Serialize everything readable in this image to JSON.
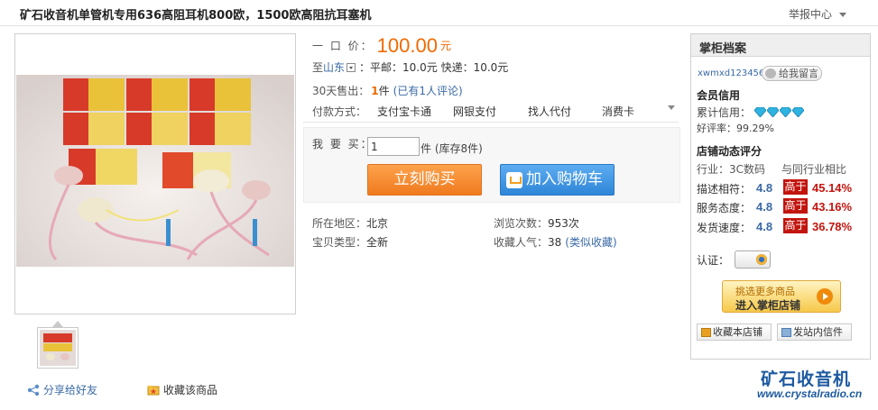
{
  "header": {
    "title": "矿石收音机单管机专用636高阻耳机800欧，1500欧高阻抗耳塞机",
    "report_label": "举报中心"
  },
  "gallery": {
    "thumb_count": 1,
    "share_label": "分享给好友",
    "collect_label": "收藏该商品"
  },
  "price": {
    "label": "一 口 价：",
    "value": "100.00",
    "unit": "元"
  },
  "shipping": {
    "to_prefix": "至",
    "destination": "山东",
    "text": "：平邮：10.0元  快递：10.0元"
  },
  "sales": {
    "label": "30天售出：",
    "count": "1",
    "unit": "件",
    "reviews": "(已有1人评论)"
  },
  "payment": {
    "label": "付款方式：",
    "options": [
      "支付宝卡通",
      "网银支付",
      "找人代付",
      "消费卡"
    ]
  },
  "purchase": {
    "qty_label": "我 要 买：",
    "qty_value": "1",
    "stock_text": "件  (库存8件)",
    "buy_now_label": "立刻购买",
    "add_cart_label": "加入购物车"
  },
  "details": {
    "region_label": "所在地区：",
    "region": "北京",
    "views_label": "浏览次数：",
    "views": "953次",
    "type_label": "宝贝类型：",
    "type": "全新",
    "fav_label": "收藏人气：",
    "fav_count": "38",
    "fav_link": "(类似收藏)"
  },
  "seller": {
    "panel_title": "掌柜档案",
    "username": "xwmxd123456",
    "message_button": "给我留言",
    "member_credit_heading": "会员信用",
    "credit_label": "累计信用：",
    "diamond_count": 4,
    "positive_rate_label": "好评率：",
    "positive_rate": "99.29%",
    "shop_rating_heading": "店铺动态评分",
    "industry_label": "行业：3C数码",
    "compare_label": "与同行业相比",
    "scores": [
      {
        "label": "描述相符：",
        "value": "4.8",
        "tag": "高于",
        "pct": "45.14%"
      },
      {
        "label": "服务态度：",
        "value": "4.8",
        "tag": "高于",
        "pct": "43.16%"
      },
      {
        "label": "发货速度：",
        "value": "4.8",
        "tag": "高于",
        "pct": "36.78%"
      }
    ],
    "cert_label": "认证：",
    "enter_shop_line1": "挑选更多商品",
    "enter_shop_line2": "进入掌柜店铺",
    "fav_shop_label": "收藏本店铺",
    "send_msg_label": "发站内信件"
  },
  "watermark": {
    "site_name": "矿石收音机",
    "url": "www.crystalradio.cn"
  },
  "colors": {
    "price_orange": "#f06a00",
    "link_blue": "#3a6aa6",
    "buy_orange": "#f07a1e",
    "cart_blue": "#2f86d8",
    "rating_red": "#c2150e"
  }
}
